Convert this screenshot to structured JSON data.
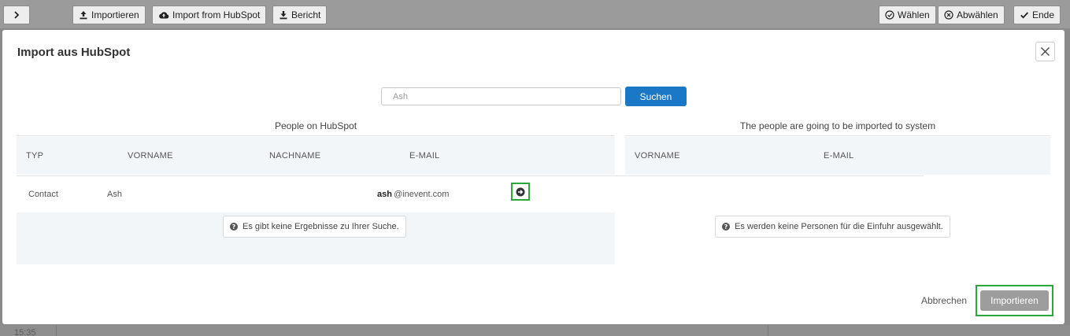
{
  "toolbar": {
    "toggle_icon": "chevron-right-icon",
    "import_label": "Importieren",
    "import_icon": "upload-icon",
    "hubspot_label": "Import from HubSpot",
    "hubspot_icon": "cloud-upload-icon",
    "report_label": "Bericht",
    "report_icon": "download-icon",
    "select_label": "Wählen",
    "select_icon": "check-circle-icon",
    "deselect_label": "Abwählen",
    "deselect_icon": "x-circle-icon",
    "done_label": "Ende",
    "done_icon": "checkmark-icon"
  },
  "background": {
    "time": "15:35"
  },
  "modal": {
    "title": "Import aus HubSpot",
    "close_icon": "close-icon",
    "search": {
      "value": "Ash",
      "button_label": "Suchen"
    },
    "left": {
      "title": "People on HubSpot",
      "columns": [
        "TYP",
        "VORNAME",
        "NACHNAME",
        "E-MAIL"
      ],
      "rows": [
        {
          "typ": "Contact",
          "vorname": "Ash",
          "nachname": "",
          "email_user": "ash",
          "email_domain": "@inevent.com",
          "action_icon": "arrow-circle-right-icon"
        }
      ],
      "empty_message": "Es gibt keine Ergebnisse zu Ihrer Suche."
    },
    "right": {
      "title": "The people are going to be imported to system",
      "columns": [
        "VORNAME",
        "E-MAIL"
      ],
      "empty_message": "Es werden keine Personen für die Einfuhr ausgewählt."
    },
    "footer": {
      "cancel_label": "Abbrechen",
      "import_label": "Importieren"
    }
  },
  "colors": {
    "primary": "#1a78c7",
    "highlight": "#2aa83a",
    "disabled": "#9d9d9d"
  }
}
